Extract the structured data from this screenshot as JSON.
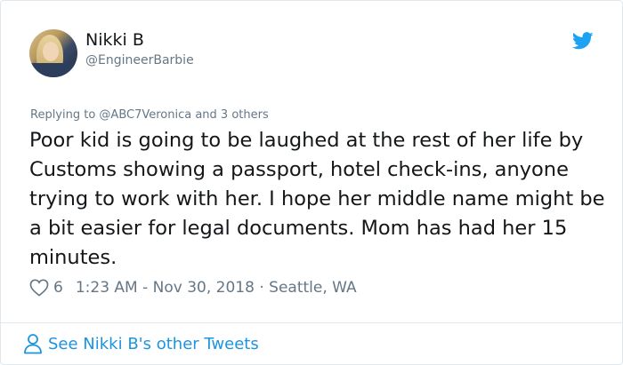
{
  "author": {
    "name": "Nikki B",
    "handle": "@EngineerBarbie"
  },
  "tweet": {
    "replying_to": "Replying to @ABC7Veronica and 3 others",
    "text": "Poor kid is going to be laughed at the rest of her life by Customs showing a passport, hotel check-ins, anyone trying to work with her. I hope her middle name might be a bit easier for legal documents. Mom has had her 15 minutes.",
    "likes": "6",
    "timestamp": "1:23 AM - Nov 30, 2018",
    "location": "Seattle, WA"
  },
  "footer": {
    "link_label": "See Nikki B's other Tweets"
  },
  "icons": {
    "bird": "twitter-bird-icon",
    "heart": "heart-icon",
    "person": "person-icon"
  },
  "colors": {
    "brand_blue": "#1da1f2",
    "link_blue": "#1b95e0",
    "muted_text": "#657786",
    "primary_text": "#14171a",
    "border": "#e1e8ed"
  }
}
